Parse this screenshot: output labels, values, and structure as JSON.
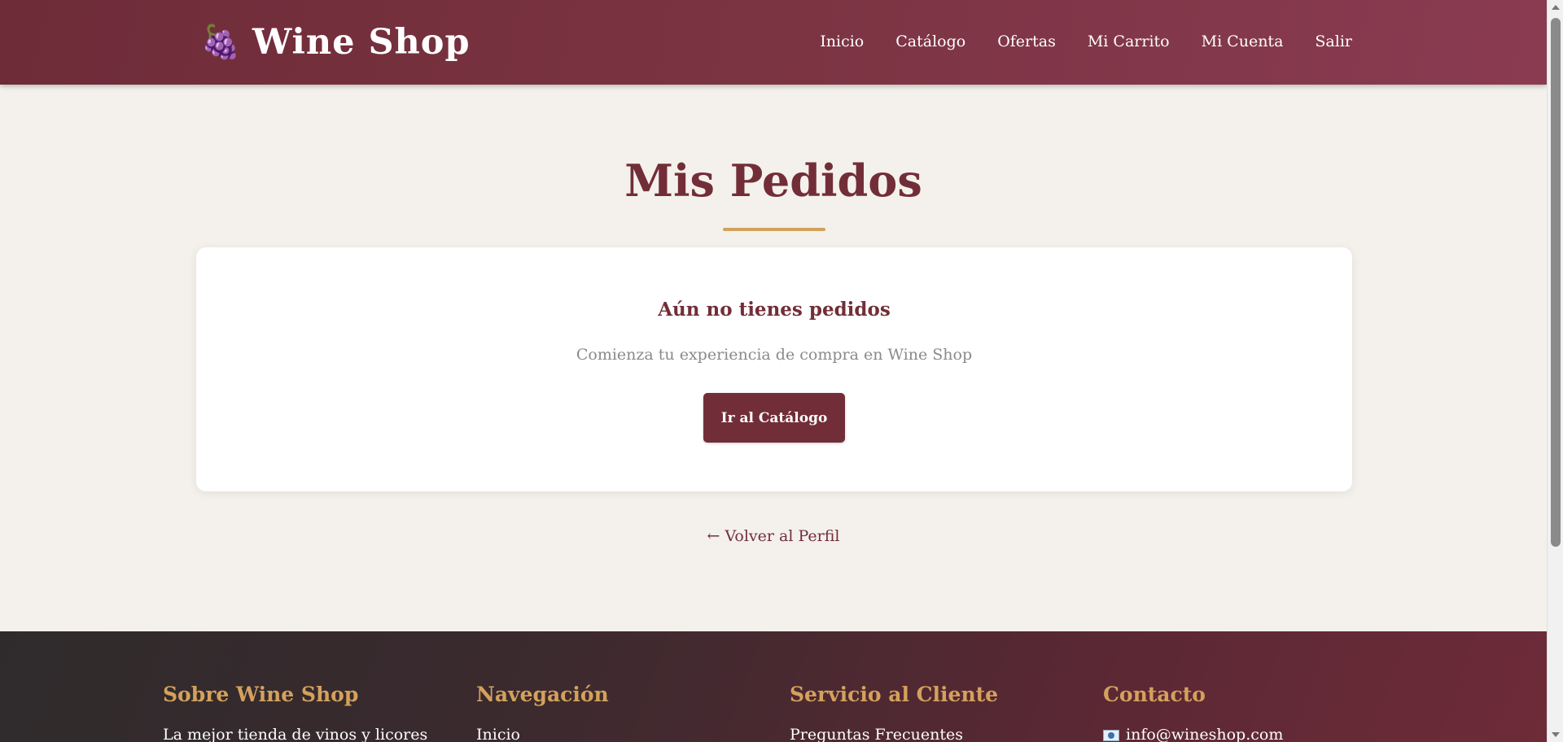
{
  "header": {
    "brand_icon": "🍇",
    "brand_name": "Wine Shop",
    "nav": [
      "Inicio",
      "Catálogo",
      "Ofertas",
      "Mi Carrito",
      "Mi Cuenta",
      "Salir"
    ]
  },
  "main": {
    "title": "Mis Pedidos",
    "empty_heading": "Aún no tienes pedidos",
    "empty_text": "Comienza tu experiencia de compra en Wine Shop",
    "catalog_button": "Ir al Catálogo",
    "back_link": "← Volver al Perfil"
  },
  "footer": {
    "about_title": "Sobre Wine Shop",
    "about_text": "La mejor tienda de vinos y licores",
    "nav_title": "Navegación",
    "nav_first": "Inicio",
    "service_title": "Servicio al Cliente",
    "service_first": "Preguntas Frecuentes",
    "contact_title": "Contacto",
    "contact_email": "info@wineshop.com"
  },
  "colors": {
    "brand": "#722e38",
    "accent": "#d4a15c",
    "background": "#f4f1ec"
  }
}
